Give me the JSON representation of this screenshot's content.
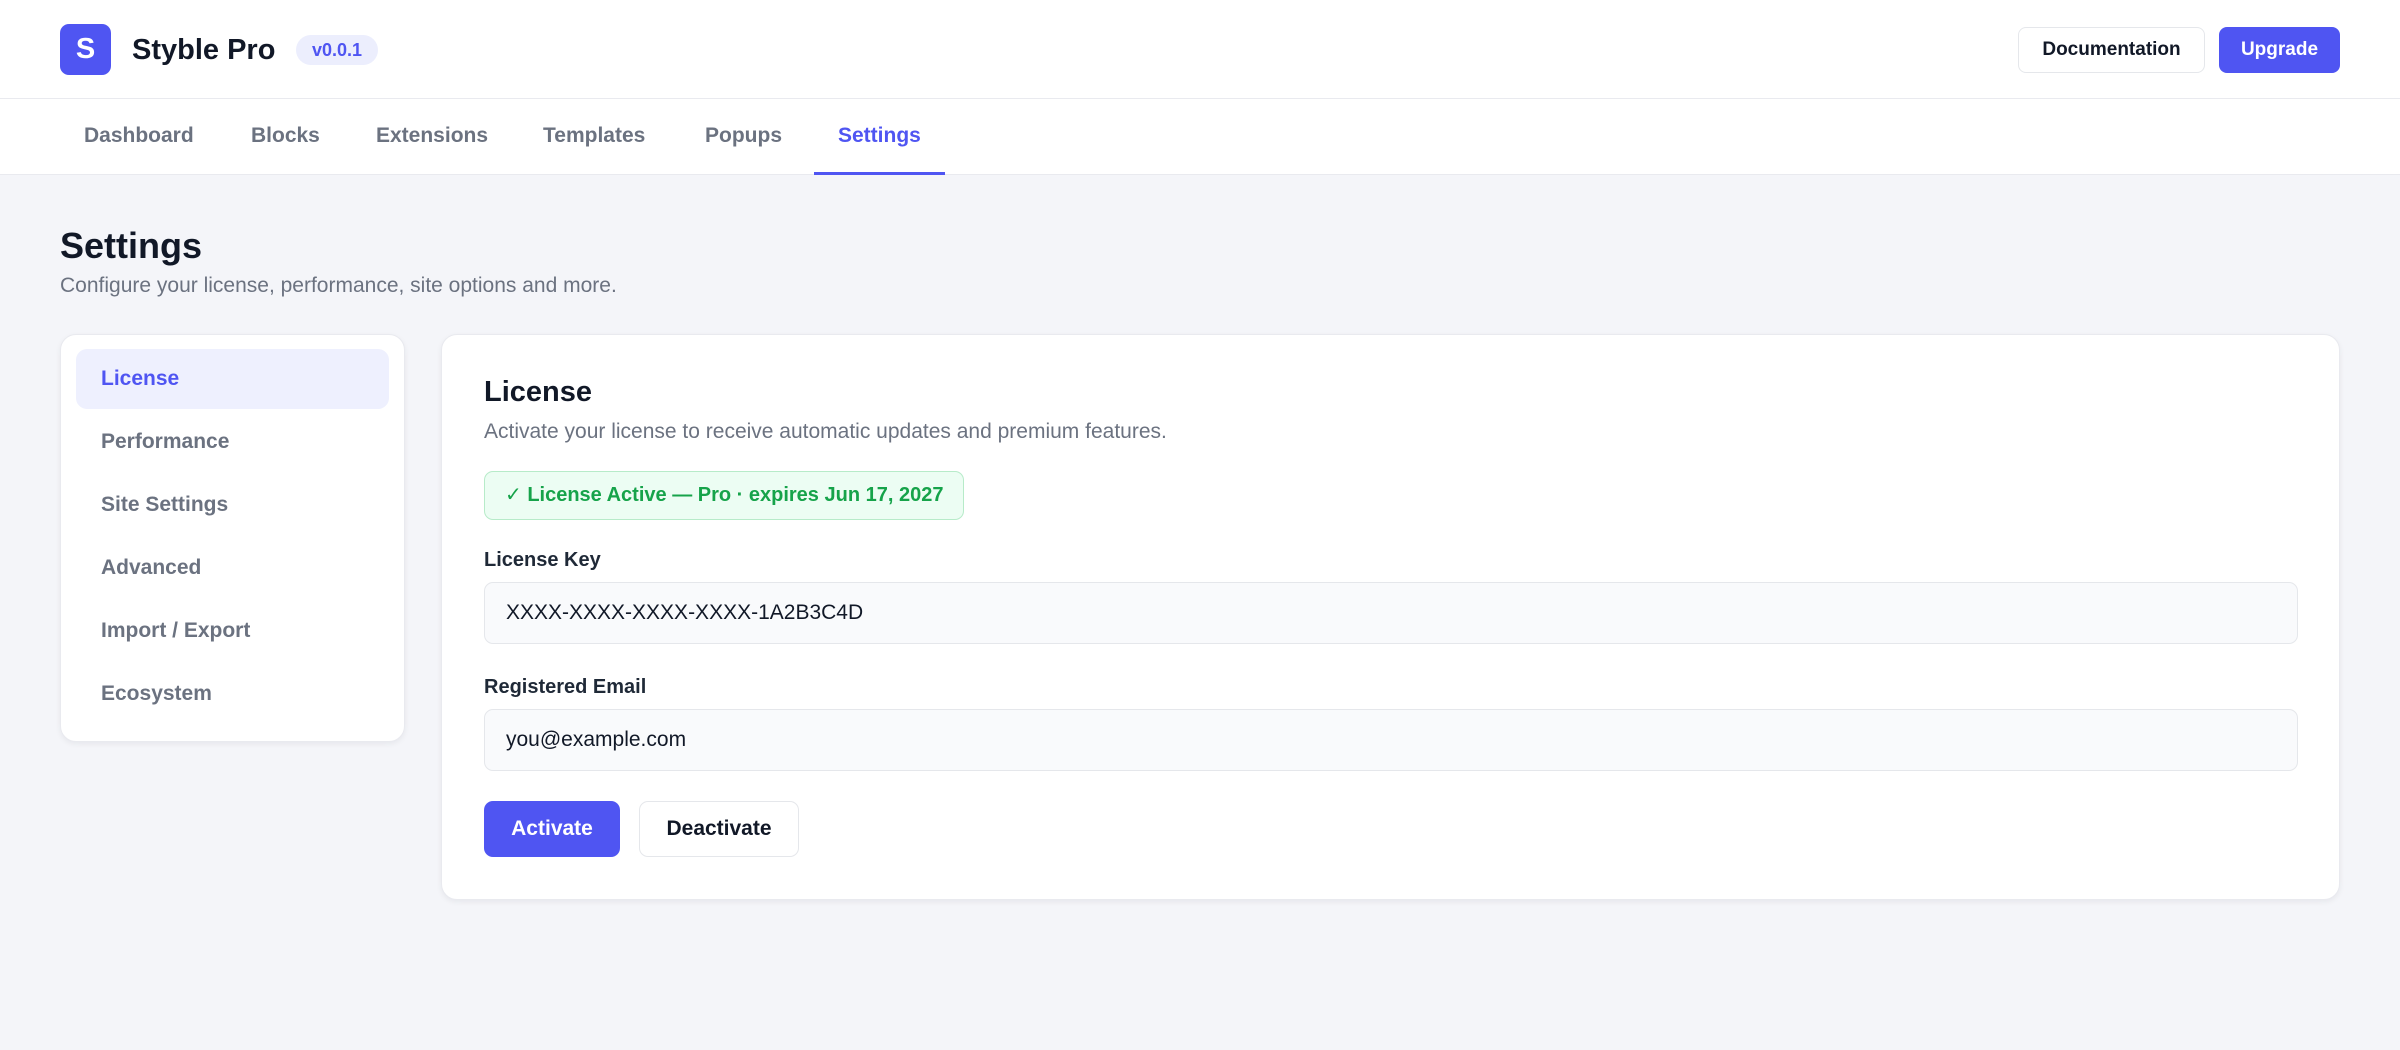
{
  "app": {
    "logo_letter": "S",
    "name": "Styble Pro",
    "version": "v0.0.1",
    "accent_color": "#4f55f2"
  },
  "header": {
    "documentation_label": "Documentation",
    "upgrade_label": "Upgrade"
  },
  "tabs": [
    {
      "label": "Dashboard",
      "active": false
    },
    {
      "label": "Blocks",
      "active": false
    },
    {
      "label": "Extensions",
      "active": false
    },
    {
      "label": "Templates",
      "active": false
    },
    {
      "label": "Popups",
      "active": false
    },
    {
      "label": "Settings",
      "active": true
    }
  ],
  "page": {
    "title": "Settings",
    "subtitle": "Configure your license, performance, site options and more."
  },
  "sidebar": {
    "items": [
      {
        "label": "License",
        "active": true
      },
      {
        "label": "Performance",
        "active": false
      },
      {
        "label": "Site Settings",
        "active": false
      },
      {
        "label": "Advanced",
        "active": false
      },
      {
        "label": "Import / Export",
        "active": false
      },
      {
        "label": "Ecosystem",
        "active": false
      }
    ]
  },
  "license": {
    "title": "License",
    "description": "Activate your license to receive automatic updates and premium features.",
    "status": "✓ License Active — Pro · expires Jun 17, 2027",
    "status_color": "#16a34a",
    "key_label": "License Key",
    "key_value": "XXXX-XXXX-XXXX-XXXX-1A2B3C4D",
    "email_label": "Registered Email",
    "email_value": "you@example.com",
    "activate_label": "Activate",
    "deactivate_label": "Deactivate"
  }
}
